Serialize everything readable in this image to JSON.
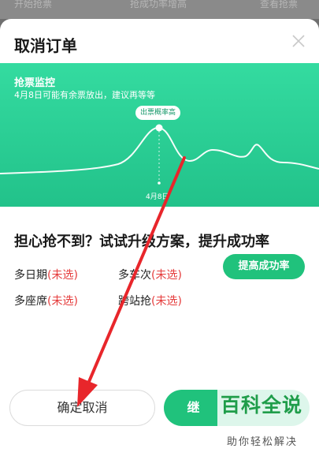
{
  "sheet": {
    "title": "取消订单"
  },
  "monitor": {
    "title": "抢票监控",
    "subtitle": "4月8日可能有余票放出，建议再等等",
    "peak_tag": "出票概率高",
    "date_label": "4月8日"
  },
  "upgrade": {
    "title": "担心抢不到？试试升级方案，提升成功率",
    "options": [
      {
        "label": "多日期",
        "status": "(未选)"
      },
      {
        "label": "多车次",
        "status": "(未选)"
      },
      {
        "label": "多座席",
        "status": "(未选)"
      },
      {
        "label": "跨站抢",
        "status": "(未选)"
      }
    ],
    "boost_label": "提高成功率"
  },
  "footer": {
    "confirm_label": "确定取消",
    "continue_label": "继"
  },
  "watermark": {
    "main": "百科全说",
    "sub": "助你轻松解决"
  },
  "colors": {
    "brand_green": "#20c27c",
    "unselected_red": "#e53c3c",
    "annotation_red": "#e8262b"
  }
}
